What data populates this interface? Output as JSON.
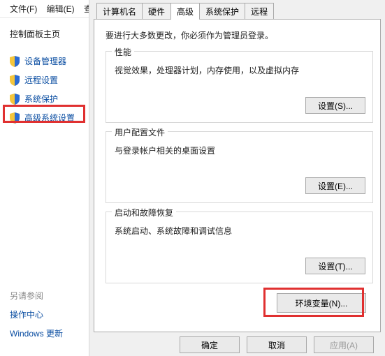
{
  "menubar": {
    "file": "文件(F)",
    "edit": "编辑(E)",
    "overflow": "查"
  },
  "sidebar": {
    "home": "控制面板主页",
    "items": [
      {
        "label": "设备管理器"
      },
      {
        "label": "远程设置"
      },
      {
        "label": "系统保护"
      },
      {
        "label": "高级系统设置"
      }
    ],
    "see_also": "另请参阅",
    "bottom_links": [
      {
        "label": "操作中心"
      },
      {
        "label": "Windows 更新"
      }
    ]
  },
  "tabs": [
    {
      "label": "计算机名"
    },
    {
      "label": "硬件"
    },
    {
      "label": "高级"
    },
    {
      "label": "系统保护"
    },
    {
      "label": "远程"
    }
  ],
  "active_tab": 2,
  "page": {
    "admin_note": "要进行大多数更改，你必须作为管理员登录。",
    "groups": {
      "perf": {
        "title": "性能",
        "desc": "视觉效果，处理器计划，内存使用，以及虚拟内存",
        "btn": "设置(S)..."
      },
      "prof": {
        "title": "用户配置文件",
        "desc": "与登录帐户相关的桌面设置",
        "btn": "设置(E)..."
      },
      "startup": {
        "title": "启动和故障恢复",
        "desc": "系统启动、系统故障和调试信息",
        "btn": "设置(T)..."
      }
    },
    "env_btn": "环境变量(N)..."
  },
  "dlg": {
    "ok": "确定",
    "cancel": "取消",
    "apply": "应用(A)"
  }
}
